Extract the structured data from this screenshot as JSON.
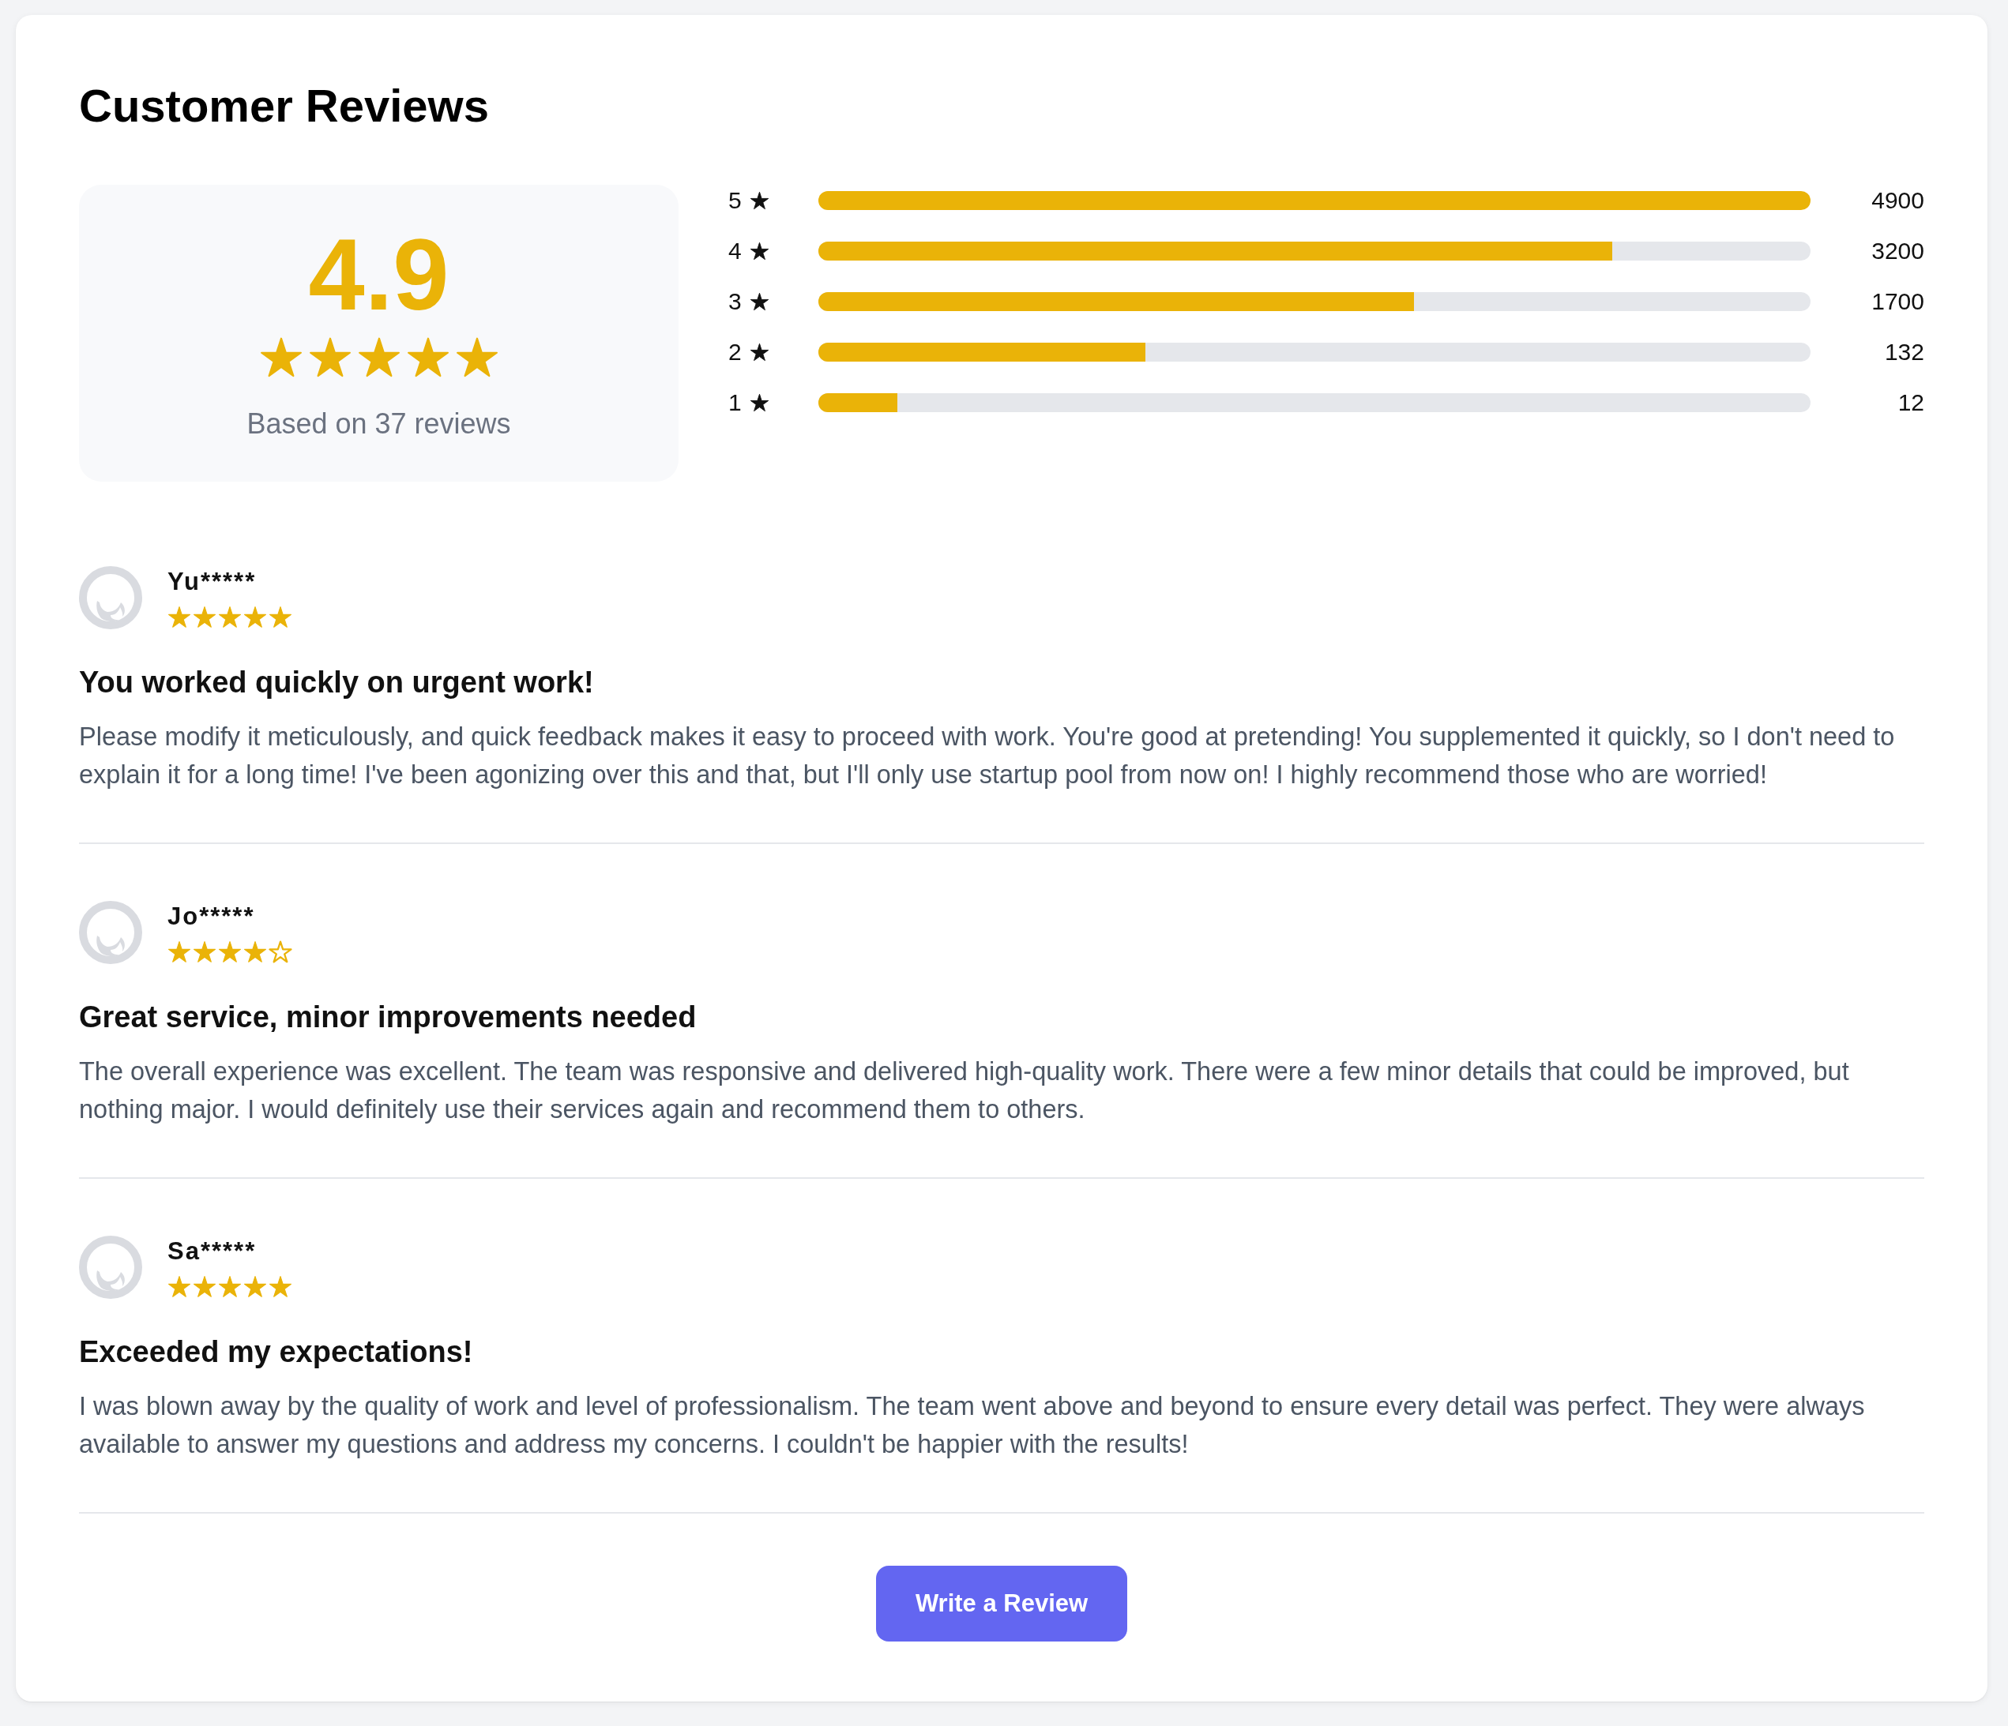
{
  "title": "Customer Reviews",
  "summary": {
    "score": "4.9",
    "stars": 5,
    "caption": "Based on 37 reviews"
  },
  "breakdown": [
    {
      "label": "5",
      "level": 1.0,
      "count": "4900"
    },
    {
      "label": "4",
      "level": 0.8,
      "count": "3200"
    },
    {
      "label": "3",
      "level": 0.6,
      "count": "1700"
    },
    {
      "label": "2",
      "level": 0.33,
      "count": "132"
    },
    {
      "label": "1",
      "level": 0.08,
      "count": "12"
    }
  ],
  "reviews": [
    {
      "name": "Yu*****",
      "stars": 5,
      "title": "You worked quickly on urgent work!",
      "body": "Please modify it meticulously, and quick feedback makes it easy to proceed with work. You're good at pretending! You supplemented it quickly, so I don't need to explain it for a long time! I've been agonizing over this and that, but I'll only use startup pool from now on! I highly recommend those who are worried!"
    },
    {
      "name": "Jo*****",
      "stars": 4,
      "title": "Great service, minor improvements needed",
      "body": "The overall experience was excellent. The team was responsive and delivered high-quality work. There were a few minor details that could be improved, but nothing major. I would definitely use their services again and recommend them to others."
    },
    {
      "name": "Sa*****",
      "stars": 5,
      "title": "Exceeded my expectations!",
      "body": "I was blown away by the quality of work and level of professionalism. The team went above and beyond to ensure every detail was perfect. They were always available to answer my questions and address my concerns. I couldn't be happier with the results!"
    }
  ],
  "button": {
    "label": "Write a Review"
  }
}
